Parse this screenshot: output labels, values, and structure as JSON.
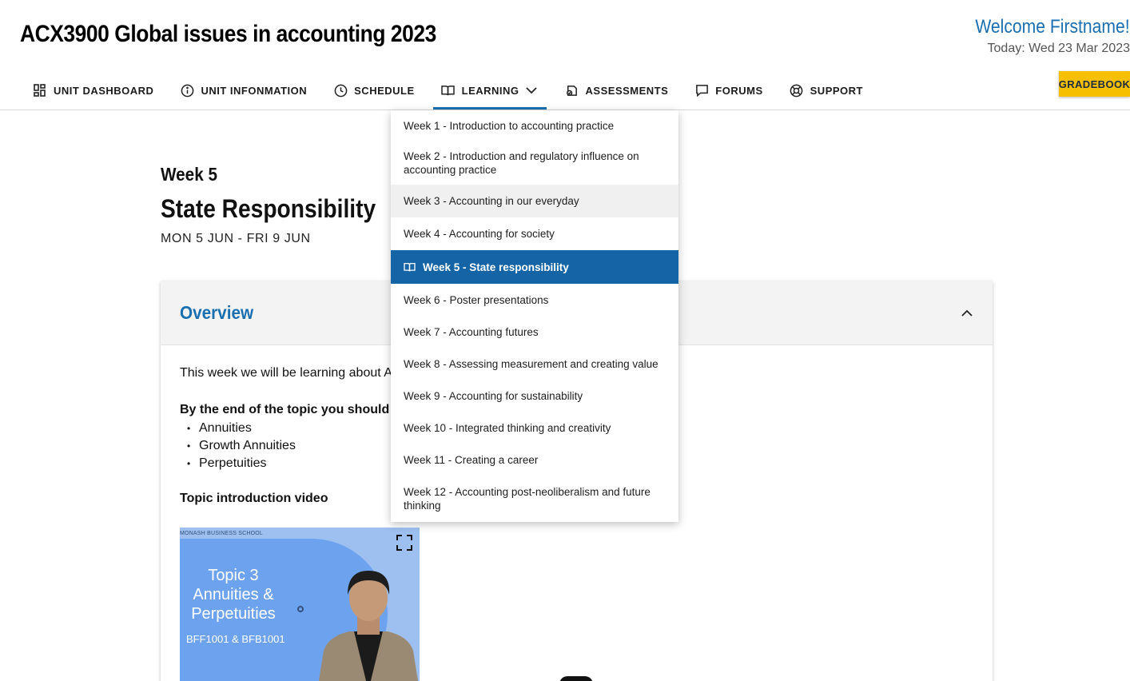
{
  "header": {
    "unit_title": "ACX3900 Global issues in accounting 2023",
    "welcome": "Welcome Firstname!",
    "today": "Today: Wed 23 Mar 2023",
    "gradebook_label": "GRADEBOOK"
  },
  "nav": {
    "items": [
      {
        "label": "UNIT DASHBOARD",
        "icon": "dashboard-icon"
      },
      {
        "label": "UNIT INFONMATION",
        "icon": "info-icon"
      },
      {
        "label": "SCHEDULE",
        "icon": "clock-icon"
      },
      {
        "label": "LEARNING",
        "icon": "book-icon",
        "active": true
      },
      {
        "label": "ASSESSMENTS",
        "icon": "assessment-icon"
      },
      {
        "label": "FORUMS",
        "icon": "chat-icon"
      },
      {
        "label": "SUPPORT",
        "icon": "lifebuoy-icon"
      }
    ]
  },
  "week": {
    "label": "Week 5",
    "title": "State Responsibility",
    "dates": "MON 5 JUN - FRI 9 JUN"
  },
  "overview": {
    "title": "Overview",
    "intro": "This week we will be learning about A",
    "objectives": "By the end of the topic you should un",
    "bullets": [
      "Annuities",
      "Growth Annuities",
      "Perpetuities"
    ],
    "video_label": "Topic introduction video"
  },
  "video": {
    "brand": "MONASH BUSINESS SCHOOL",
    "topic_line1": "Topic 3",
    "topic_line2": "Annuities &",
    "topic_line3": "Perpetuities",
    "codes": "BFF1001 & BFB1001"
  },
  "dropdown": {
    "items": [
      {
        "label": "Week 1 - Introduction to accounting practice"
      },
      {
        "label": "Week 2 - Introduction and regulatory influence on accounting practice"
      },
      {
        "label": "Week 3 - Accounting in our everyday",
        "state": "hover"
      },
      {
        "label": "Week 4 - Accounting for society"
      },
      {
        "label": "Week 5 - State responsibility",
        "state": "selected"
      },
      {
        "label": "Week 6 - Poster presentations"
      },
      {
        "label": "Week 7 - Accounting futures"
      },
      {
        "label": "Week 8 - Assessing measurement and creating value"
      },
      {
        "label": "Week 9 - Accounting for sustainability"
      },
      {
        "label": "Week 10 - Integrated thinking and creativity"
      },
      {
        "label": "Week 11 - Creating a career"
      },
      {
        "label": "Week 12 - Accounting post-neoliberalism and future thinking"
      }
    ]
  },
  "colors": {
    "accent": "#1a6fb0",
    "selected": "#1565a6",
    "gradebook": "#f6bf00"
  }
}
